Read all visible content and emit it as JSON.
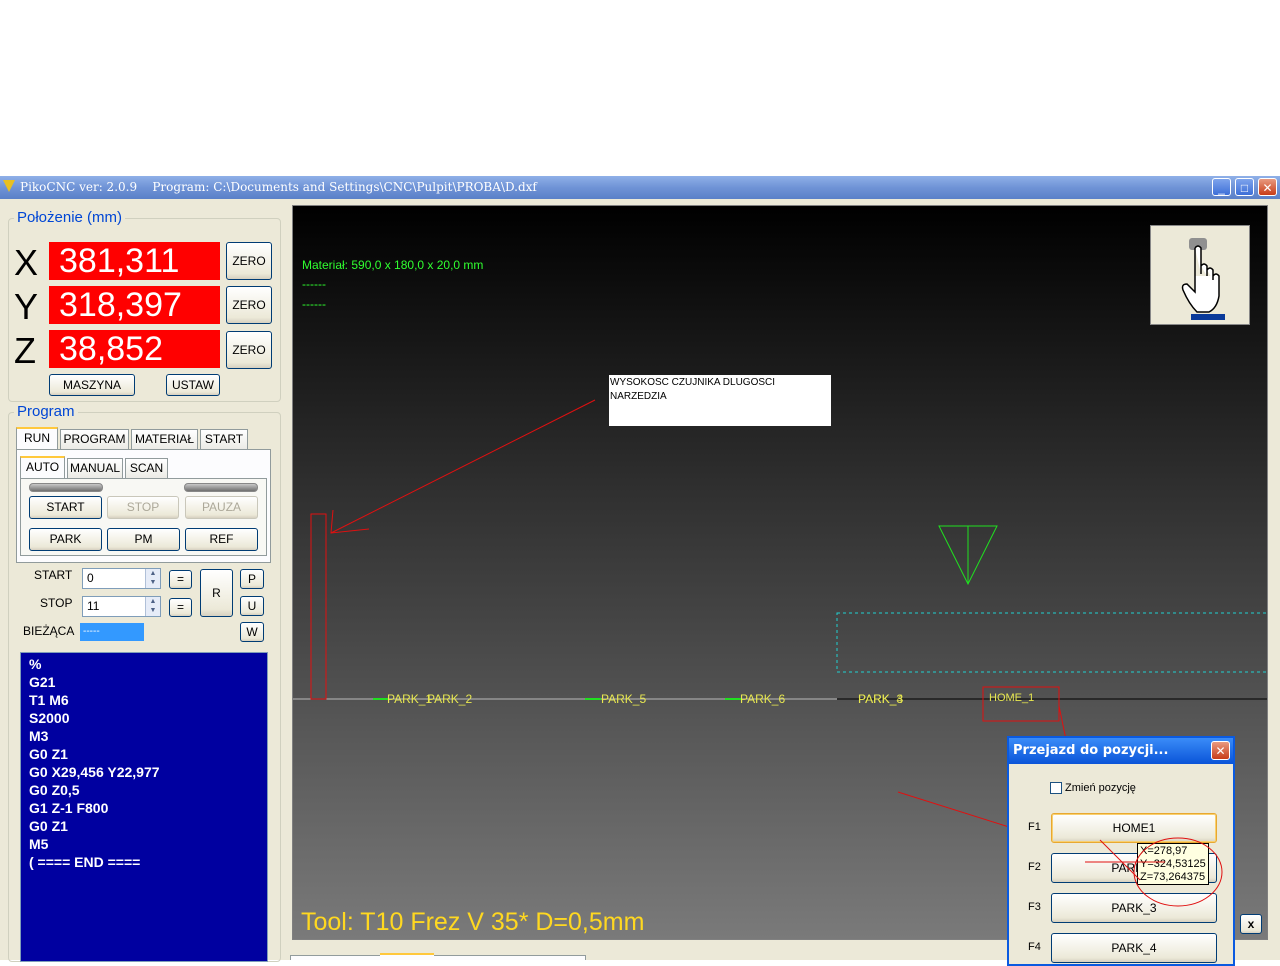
{
  "window": {
    "title": "PikoCNC ver: 2.0.9    Program: C:\\Documents and Settings\\CNC\\Pulpit\\PROBA\\D.dxf",
    "minimize": "_",
    "maximize": "□",
    "close": "✕"
  },
  "position": {
    "title": "Położenie (mm)",
    "axes": [
      {
        "label": "X",
        "value": "381,311",
        "zero": "ZERO"
      },
      {
        "label": "Y",
        "value": "318,397",
        "zero": "ZERO"
      },
      {
        "label": "Z",
        "value": "38,852",
        "zero": "ZERO"
      }
    ],
    "machine_button": "MASZYNA",
    "set_button": "USTAW",
    "readout_color": "#ff0000"
  },
  "program": {
    "title": "Program",
    "tabs": [
      "RUN",
      "PROGRAM",
      "MATERIAŁ",
      "START"
    ],
    "subtabs": [
      "AUTO",
      "MANUAL",
      "SCAN"
    ],
    "start_button": "START",
    "stop_button": "STOP",
    "pause_button": "PAUZA",
    "park_button": "PARK",
    "pm_button": "PM",
    "ref_button": "REF",
    "start_label": "START",
    "start_value": "0",
    "stop_label": "STOP",
    "stop_value": "11",
    "current_label": "BIEŻĄCA",
    "current_value": "-----",
    "eq_button": "=",
    "r_button": "R",
    "p_button": "P",
    "u_button": "U",
    "w_button": "W"
  },
  "gcode": [
    "%",
    "G21",
    "T1 M6",
    "S2000",
    "M3",
    "G0 Z1",
    "G0 X29,456 Y22,977",
    "G0 Z0,5",
    "G1 Z-1 F800",
    "G0 Z1",
    "M5",
    "( ==== END ===="
  ],
  "canvas": {
    "material": "Materiał: 590,0 x 180,0 x 20,0 mm",
    "line2": "------",
    "line3": "------",
    "note": "WYSOKOSC CZUJNIKA DLUGOSCI NARZEDZIA",
    "park_labels": [
      "PARK_1",
      "PARK_2",
      "PARK_5",
      "PARK_6",
      "PARK_3",
      "PARK_4",
      "HOME_1"
    ],
    "tool": "Tool: T10 Frez V 35* D=0,5mm",
    "hand_icon": "hand-pointer-icon",
    "close_x": "x"
  },
  "dialog": {
    "title": "Przejazd do pozycji...",
    "checkbox_label": "Zmień pozycję",
    "rows": [
      {
        "key": "F1",
        "label": "HOME1"
      },
      {
        "key": "F2",
        "label": "PARK_1"
      },
      {
        "key": "F3",
        "label": "PARK_3"
      },
      {
        "key": "F4",
        "label": "PARK_4"
      }
    ],
    "tooltip": "X=278,97\nY=324,53125\nZ=73,264375"
  },
  "colors": {
    "accent": "#0046d5",
    "gcode_bg": "#0000a0",
    "tool_text": "#ffd820",
    "path_text": "#30ff30"
  }
}
